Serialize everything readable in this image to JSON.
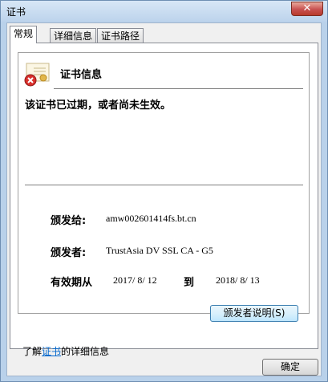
{
  "window": {
    "title": "证书",
    "close_glyph": "✕"
  },
  "tabs": [
    {
      "label": "常规",
      "active": true
    },
    {
      "label": "详细信息",
      "active": false
    },
    {
      "label": "证书路径",
      "active": false
    }
  ],
  "certificate": {
    "heading": "证书信息",
    "status_message": "该证书已过期，或者尚未生效。",
    "issued_to_label": "颁发给:",
    "issued_to_value": "amw002601414fs.bt.cn",
    "issued_by_label": "颁发者:",
    "issued_by_value": "TrustAsia DV SSL CA - G5",
    "valid_from_label": "有效期从",
    "valid_from_value": "2017/ 8/ 12",
    "valid_to_label": "到",
    "valid_to_value": "2018/ 8/ 13"
  },
  "buttons": {
    "issuer_statement": "颁发者说明(S)",
    "ok": "确定"
  },
  "learn_more": {
    "prefix": "了解",
    "link": "证书",
    "suffix": "的详细信息"
  },
  "icons": {
    "certificate": "certificate-error-icon"
  },
  "colors": {
    "error_red": "#d9302c",
    "link": "#0066cc",
    "titlebar": "#bcd3ec"
  }
}
